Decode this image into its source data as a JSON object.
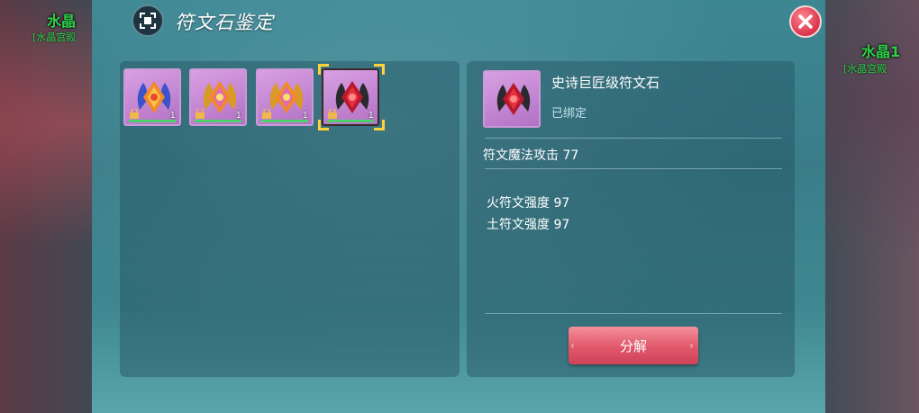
{
  "scene": {
    "left_label": "水晶",
    "left_sub": "[水晶宫殿",
    "right_label": "水晶1",
    "right_sub": "[水晶宫殿"
  },
  "dialog": {
    "title": "符文石鉴定",
    "close_icon": "close-icon"
  },
  "inventory": {
    "slots": [
      {
        "icon": "blue-rune-stone",
        "count": "1",
        "locked": true
      },
      {
        "icon": "gold-rune-stone",
        "count": "1",
        "locked": true
      },
      {
        "icon": "gold-rune-stone",
        "count": "1",
        "locked": true
      },
      {
        "icon": "red-rune-stone",
        "count": "1",
        "locked": true,
        "selected": true
      }
    ]
  },
  "detail": {
    "name": "史诗巨匠级符文石",
    "bound": "已绑定",
    "main_stat": "符文魔法攻击 77",
    "sub_stats": [
      "火符文强度 97",
      "土符文强度 97"
    ],
    "decompose_label": "分解"
  },
  "colors": {
    "accent_button": "#e0576a",
    "stat_bar": "#4cd16b",
    "select_border": "#ffd23a",
    "name_green": "#2fd14a"
  }
}
